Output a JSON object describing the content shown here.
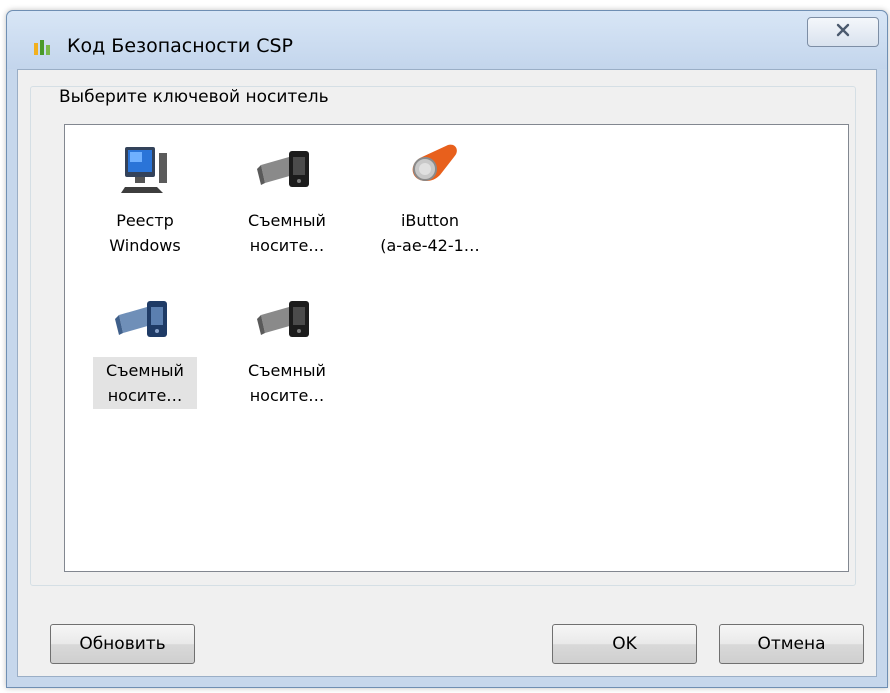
{
  "window": {
    "title": "Код Безопасности CSP",
    "close_label": "✕"
  },
  "group": {
    "label": "Выберите ключевой носитель"
  },
  "items": [
    {
      "line1": "Реестр",
      "line2": "Windows",
      "icon": "computer-icon"
    },
    {
      "line1": "Съемный",
      "line2": "носите…",
      "icon": "removable-drive-icon"
    },
    {
      "line1": "iButton",
      "line2": "(a-ae-42-1…",
      "icon": "ibutton-icon"
    },
    {
      "line1": "Съемный",
      "line2": "носите…",
      "icon": "removable-drive-icon",
      "selected": true
    },
    {
      "line1": "Съемный",
      "line2": "носите…",
      "icon": "removable-drive-icon"
    }
  ],
  "buttons": {
    "refresh": "Обновить",
    "ok": "OK",
    "cancel": "Отмена"
  }
}
